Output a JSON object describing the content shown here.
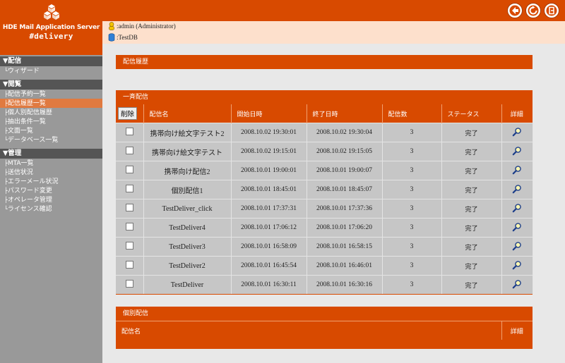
{
  "app": {
    "product_line1": "HDE Mail Application Server",
    "product_line2": "#delivery"
  },
  "userbar": {
    "user": ":admin (Administrator)",
    "db": ":TestDB"
  },
  "topbar_icons": [
    "back-icon",
    "refresh-icon",
    "logout-icon"
  ],
  "sidebar": {
    "sections": [
      {
        "title": "▼配信",
        "items": [
          {
            "label": "ウィザード"
          }
        ]
      },
      {
        "title": "▼閲覧",
        "items": [
          {
            "label": "配信予約一覧"
          },
          {
            "label": "配信履歴一覧",
            "active": true
          },
          {
            "label": "個人別配信履歴"
          },
          {
            "label": "抽出条件一覧"
          },
          {
            "label": "文面一覧"
          },
          {
            "label": "データベース一覧"
          }
        ]
      },
      {
        "title": "▼管理",
        "items": [
          {
            "label": "MTA一覧"
          },
          {
            "label": "送信状況"
          },
          {
            "label": "エラーメール状況"
          },
          {
            "label": "パスワード変更"
          },
          {
            "label": "オペレータ管理"
          },
          {
            "label": "ライセンス確認"
          }
        ]
      }
    ]
  },
  "page": {
    "title": "配信履歴"
  },
  "bulk": {
    "title": "一斉配信",
    "delete_label": "削除",
    "columns": [
      "配信名",
      "開始日時",
      "終了日時",
      "配信数",
      "ステータス",
      "詳細"
    ],
    "rows": [
      {
        "name": "携帯向け絵文字テスト2",
        "start": "2008.10.02 19:30:01",
        "end": "2008.10.02 19:30:04",
        "count": "3",
        "status": "完了"
      },
      {
        "name": "携帯向け絵文字テスト",
        "start": "2008.10.02 19:15:01",
        "end": "2008.10.02 19:15:05",
        "count": "3",
        "status": "完了"
      },
      {
        "name": "携帯向け配信2",
        "start": "2008.10.01 19:00:01",
        "end": "2008.10.01 19:00:07",
        "count": "3",
        "status": "完了"
      },
      {
        "name": "個別配信1",
        "start": "2008.10.01 18:45:01",
        "end": "2008.10.01 18:45:07",
        "count": "3",
        "status": "完了"
      },
      {
        "name": "TestDeliver_click",
        "start": "2008.10.01 17:37:31",
        "end": "2008.10.01 17:37:36",
        "count": "3",
        "status": "完了"
      },
      {
        "name": "TestDeliver4",
        "start": "2008.10.01 17:06:12",
        "end": "2008.10.01 17:06:20",
        "count": "3",
        "status": "完了"
      },
      {
        "name": "TestDeliver3",
        "start": "2008.10.01 16:58:09",
        "end": "2008.10.01 16:58:15",
        "count": "3",
        "status": "完了"
      },
      {
        "name": "TestDeliver2",
        "start": "2008.10.01 16:45:54",
        "end": "2008.10.01 16:46:01",
        "count": "3",
        "status": "完了"
      },
      {
        "name": "TestDeliver",
        "start": "2008.10.01 16:30:11",
        "end": "2008.10.01 16:30:16",
        "count": "3",
        "status": "完了"
      }
    ]
  },
  "individual": {
    "title": "個別配信",
    "columns": [
      "配信名",
      "詳細"
    ]
  }
}
